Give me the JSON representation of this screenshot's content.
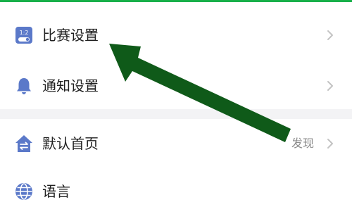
{
  "settings": {
    "items": [
      {
        "label": "比赛设置",
        "icon": "scoreboard-toggle-icon",
        "value": ""
      },
      {
        "label": "通知设置",
        "icon": "bell-icon",
        "value": ""
      },
      {
        "label": "默认首页",
        "icon": "home-swap-icon",
        "value": "发现"
      },
      {
        "label": "语言",
        "icon": "globe-icon",
        "value": ""
      }
    ],
    "match_icon_text": "1:2"
  },
  "colors": {
    "accent": "#18b04a",
    "icon_blue": "#5b79c9",
    "arrow_green": "#0f5a19"
  }
}
